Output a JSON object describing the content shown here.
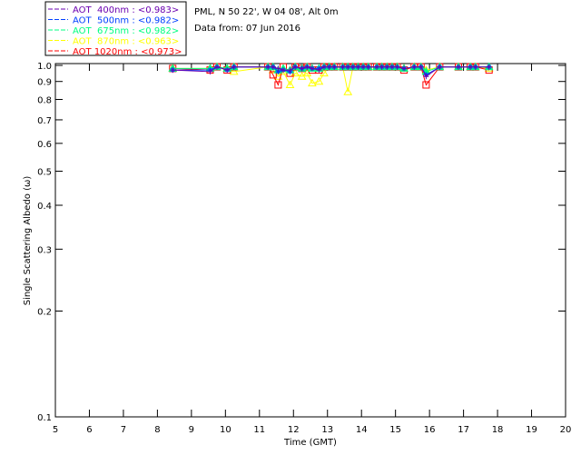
{
  "header": {
    "line1": "PML, N 50 22', W 04 08', Alt 0m",
    "line2": "Data from: 07 Jun 2016"
  },
  "chart_data": {
    "type": "scatter",
    "xlabel": "Time (GMT)",
    "ylabel": "Single Scattering Albedo (ω)",
    "xlim": [
      5,
      20
    ],
    "ylim": [
      0.1,
      1.0
    ],
    "yscale": "log",
    "xticks": [
      "5",
      "6",
      "7",
      "8",
      "9",
      "10",
      "11",
      "12",
      "13",
      "14",
      "15",
      "16",
      "17",
      "18",
      "19",
      "20"
    ],
    "yticks": [
      "0.1",
      "0.2",
      "0.3",
      "0.4",
      "0.5",
      "0.6",
      "0.7",
      "0.8",
      "0.9",
      "1.0"
    ],
    "legend_position": "top-left (outside)",
    "x": [
      8.45,
      9.55,
      9.75,
      10.05,
      10.25,
      11.25,
      11.4,
      11.55,
      11.7,
      11.9,
      12.05,
      12.25,
      12.4,
      12.55,
      12.75,
      12.9,
      13.05,
      13.2,
      13.45,
      13.6,
      13.75,
      13.9,
      14.05,
      14.2,
      14.45,
      14.6,
      14.75,
      14.9,
      15.05,
      15.25,
      15.55,
      15.75,
      15.9,
      16.3,
      16.85,
      17.2,
      17.35,
      17.75
    ],
    "series": [
      {
        "name": "AOT  400nm : <0.983>",
        "color": "#6a00b0",
        "marker": "plus",
        "values": [
          0.97,
          0.96,
          0.99,
          0.97,
          0.99,
          0.99,
          0.99,
          0.98,
          0.97,
          0.97,
          0.99,
          0.98,
          0.99,
          0.98,
          0.97,
          0.99,
          0.99,
          0.99,
          0.99,
          0.99,
          0.99,
          0.99,
          0.99,
          0.99,
          0.99,
          0.99,
          0.99,
          0.99,
          0.99,
          0.98,
          0.99,
          0.99,
          0.93,
          0.99,
          0.99,
          0.99,
          0.99,
          0.99
        ]
      },
      {
        "name": "AOT  500nm : <0.982>",
        "color": "#0040ff",
        "marker": "asterisk",
        "values": [
          0.97,
          0.97,
          0.99,
          0.97,
          0.99,
          0.99,
          0.99,
          0.96,
          0.97,
          0.96,
          0.99,
          0.98,
          0.99,
          0.98,
          0.98,
          0.99,
          0.99,
          0.99,
          0.99,
          0.99,
          0.99,
          0.99,
          0.99,
          0.99,
          0.99,
          0.99,
          0.99,
          0.99,
          0.99,
          0.98,
          0.99,
          0.99,
          0.94,
          0.99,
          0.99,
          0.99,
          0.99,
          0.99
        ]
      },
      {
        "name": "AOT  675nm : <0.982>",
        "color": "#00ff80",
        "marker": "triangle",
        "values": [
          0.98,
          0.98,
          0.99,
          0.98,
          0.99,
          0.99,
          0.99,
          0.97,
          0.98,
          0.97,
          0.99,
          0.98,
          0.99,
          0.98,
          0.98,
          0.99,
          0.99,
          0.99,
          0.99,
          0.99,
          0.99,
          0.99,
          0.99,
          0.99,
          0.99,
          0.99,
          0.99,
          0.99,
          0.99,
          0.98,
          0.99,
          0.99,
          0.96,
          0.99,
          0.99,
          0.99,
          0.99,
          0.99
        ]
      },
      {
        "name": "AOT  870nm : <0.963>",
        "color": "#ffff00",
        "marker": "triangle",
        "values": [
          0.98,
          0.98,
          0.99,
          0.98,
          0.96,
          0.99,
          0.97,
          0.93,
          0.96,
          0.88,
          0.95,
          0.93,
          0.95,
          0.89,
          0.9,
          0.95,
          0.99,
          0.99,
          0.99,
          0.84,
          0.99,
          0.99,
          0.99,
          0.99,
          0.99,
          0.99,
          0.99,
          0.99,
          0.99,
          0.98,
          0.99,
          0.99,
          0.97,
          0.99,
          0.99,
          0.99,
          0.99,
          0.98
        ]
      },
      {
        "name": "AOT 1020nm : <0.973>",
        "color": "#ff0000",
        "marker": "square",
        "values": [
          0.98,
          0.97,
          0.99,
          0.97,
          0.99,
          0.99,
          0.94,
          0.88,
          0.99,
          0.95,
          0.99,
          0.98,
          0.99,
          0.97,
          0.97,
          0.99,
          0.99,
          0.99,
          0.99,
          0.99,
          0.99,
          0.99,
          0.99,
          0.99,
          0.99,
          0.99,
          0.99,
          0.99,
          0.99,
          0.97,
          0.99,
          0.99,
          0.88,
          0.99,
          0.99,
          0.99,
          0.99,
          0.97
        ]
      }
    ]
  }
}
